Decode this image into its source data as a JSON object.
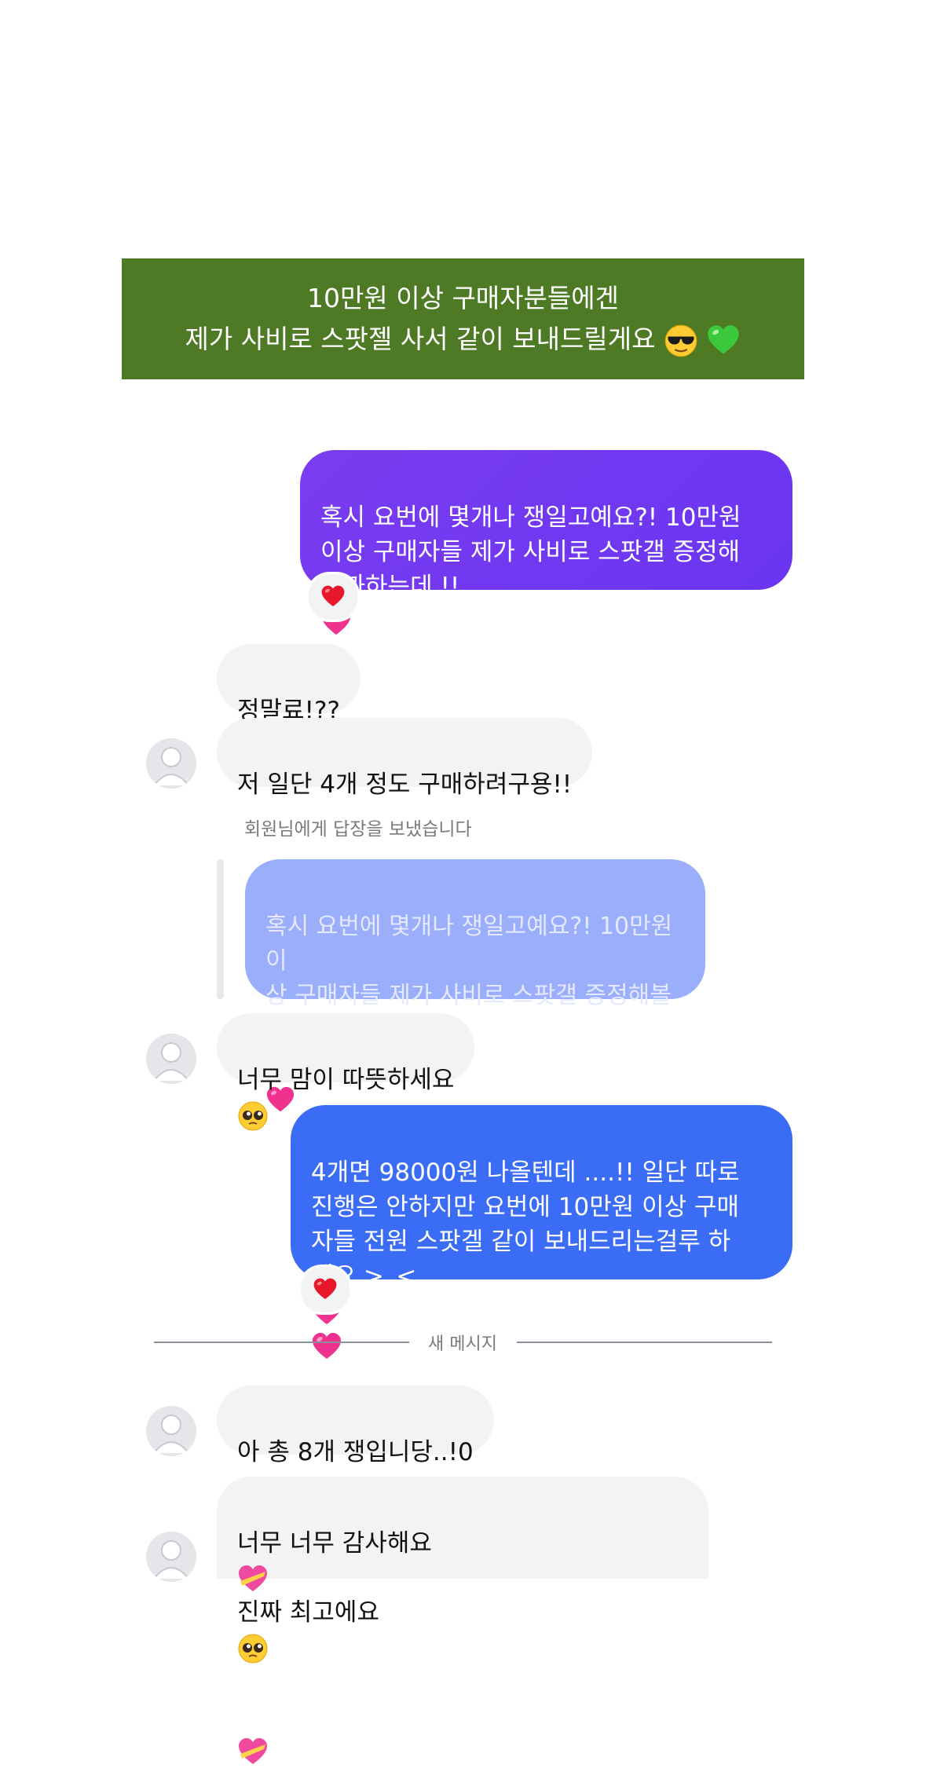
{
  "banner": {
    "line1": "10만원 이상 구매자분들에겐",
    "line2": "제가 사비로 스팟젤 사서 같이 보내드릴게요"
  },
  "messages": {
    "sent_1": "혹시 요번에 몇개나 쟁일고예요?! 10만원\n이상 구매자들 제가 사비로 스팟갤 증정해\n볼까하는데 !!",
    "recv_1": "정말료!??",
    "recv_2": "저 일단 4개 정도 구매하려구용!!",
    "reply_note": "회원님에게 답장을 보냈습니다",
    "quoted": "혹시 요번에 몇개나 쟁일고예요?! 10만원 이\n상 구매자들 제가 사비로 스팟갤 증정해볼까\n하는데 !!",
    "recv_3": "너무 맘이 따뜻하세요",
    "sent_2": "4개면 98000원 나올텐데 ....!! 일단 따로\n진행은 안하지만 요번에 10만원 이상 구매\n자들 전원 스팟겔 같이 보내드리는걸루 하\n께요 >_<",
    "divider": "새 메시지",
    "recv_4": "아 총 8개 쟁입니당..!0",
    "recv_5": "너무 너무 감사해요",
    "recv_5b": "진짜 최고에요"
  },
  "icons": {
    "reaction": "red-heart-icon",
    "avatar": "default-avatar-icon",
    "emoji_sunglasses": "sunglasses-emoji",
    "emoji_green_heart": "green-heart-emoji",
    "emoji_pink_heart": "pink-heart-emoji",
    "emoji_pleading": "pleading-face-emoji",
    "emoji_heart_ribbon": "heart-with-ribbon-emoji"
  },
  "colors": {
    "banner_bg": "#4e7a26",
    "sent_purple": "#6a35f2",
    "sent_blue": "#3b6cf6",
    "quoted_bg": "#9aaefb",
    "received_bg": "#f2f3f5"
  }
}
